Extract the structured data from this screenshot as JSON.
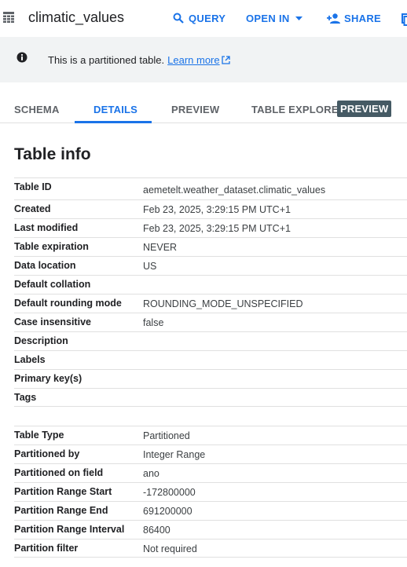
{
  "header": {
    "title": "climatic_values",
    "query_label": "QUERY",
    "open_in_label": "OPEN IN",
    "share_label": "SHARE"
  },
  "banner": {
    "message": "This is a partitioned table.",
    "link_label": "Learn more"
  },
  "tabs": {
    "schema": "SCHEMA",
    "details": "DETAILS",
    "preview": "PREVIEW",
    "table_explorer": "TABLE EXPLORER",
    "preview_badge": "PREVIEW",
    "active": "DETAILS"
  },
  "table_info": {
    "title": "Table info",
    "rows": [
      {
        "key": "Table ID",
        "value": "aemetelt.weather_dataset.climatic_values"
      },
      {
        "key": "Created",
        "value": "Feb 23, 2025, 3:29:15 PM UTC+1"
      },
      {
        "key": "Last modified",
        "value": "Feb 23, 2025, 3:29:15 PM UTC+1"
      },
      {
        "key": "Table expiration",
        "value": "NEVER"
      },
      {
        "key": "Data location",
        "value": "US"
      },
      {
        "key": "Default collation",
        "value": ""
      },
      {
        "key": "Default rounding mode",
        "value": "ROUNDING_MODE_UNSPECIFIED"
      },
      {
        "key": "Case insensitive",
        "value": "false"
      },
      {
        "key": "Description",
        "value": ""
      },
      {
        "key": "Labels",
        "value": ""
      },
      {
        "key": "Primary key(s)",
        "value": ""
      },
      {
        "key": "Tags",
        "value": ""
      }
    ],
    "partition_rows": [
      {
        "key": "Table Type",
        "value": "Partitioned"
      },
      {
        "key": "Partitioned by",
        "value": "Integer Range"
      },
      {
        "key": "Partitioned on field",
        "value": "ano"
      },
      {
        "key": "Partition Range Start",
        "value": "-172800000"
      },
      {
        "key": "Partition Range End",
        "value": "691200000"
      },
      {
        "key": "Partition Range Interval",
        "value": "86400"
      },
      {
        "key": "Partition filter",
        "value": "Not required"
      }
    ]
  },
  "colors": {
    "accent": "#1a73e8",
    "banner_bg": "#f1f3f4",
    "badge_bg": "#455a64"
  }
}
